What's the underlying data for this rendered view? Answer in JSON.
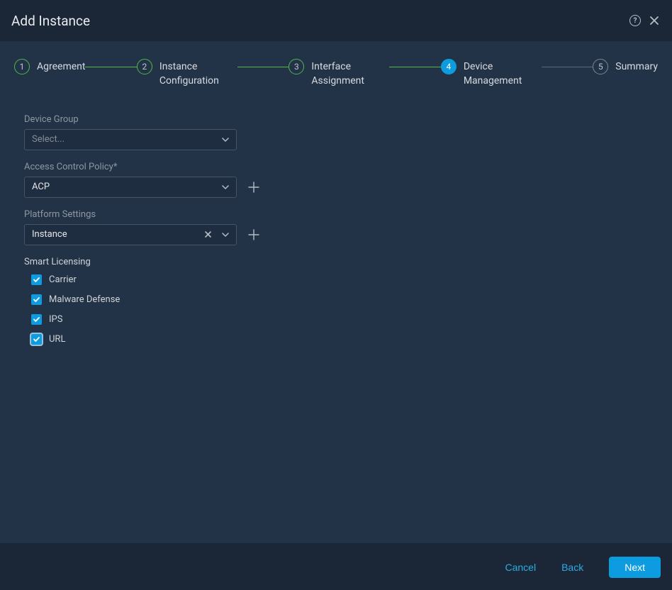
{
  "header": {
    "title": "Add Instance"
  },
  "stepper": {
    "steps": [
      {
        "num": "1",
        "label": "Agreement"
      },
      {
        "num": "2",
        "label": "Instance Configuration"
      },
      {
        "num": "3",
        "label": "Interface Assignment"
      },
      {
        "num": "4",
        "label": "Device Management"
      },
      {
        "num": "5",
        "label": "Summary"
      }
    ]
  },
  "form": {
    "device_group": {
      "label": "Device Group",
      "placeholder": "Select..."
    },
    "access_control_policy": {
      "label": "Access Control Policy*",
      "value": "ACP"
    },
    "platform_settings": {
      "label": "Platform Settings",
      "value": "Instance"
    },
    "smart_licensing": {
      "title": "Smart Licensing",
      "options": [
        {
          "label": "Carrier",
          "checked": true
        },
        {
          "label": "Malware Defense",
          "checked": true
        },
        {
          "label": "IPS",
          "checked": true
        },
        {
          "label": "URL",
          "checked": true
        }
      ]
    }
  },
  "footer": {
    "cancel": "Cancel",
    "back": "Back",
    "next": "Next"
  }
}
